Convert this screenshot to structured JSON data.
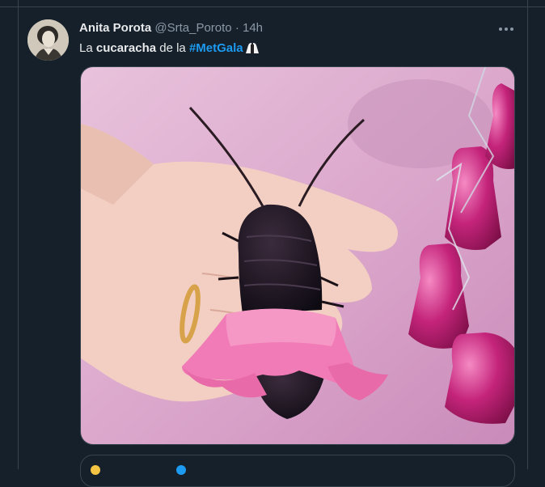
{
  "tweet": {
    "author_name": "Anita Porota",
    "author_handle": "@Srta_Poroto",
    "separator": "·",
    "time": "14h",
    "text_parts": {
      "prefix": "La ",
      "bold": "cucaracha",
      "middle": " de la ",
      "hashtag": "#MetGala"
    },
    "emoji_icon": "dress-emoji-icon",
    "more_icon": "more-options-icon"
  },
  "colors": {
    "background": "#15202b",
    "border": "#38444d",
    "text": "#e7e9ea",
    "muted": "#8b98a5",
    "accent": "#1d9bf0"
  }
}
